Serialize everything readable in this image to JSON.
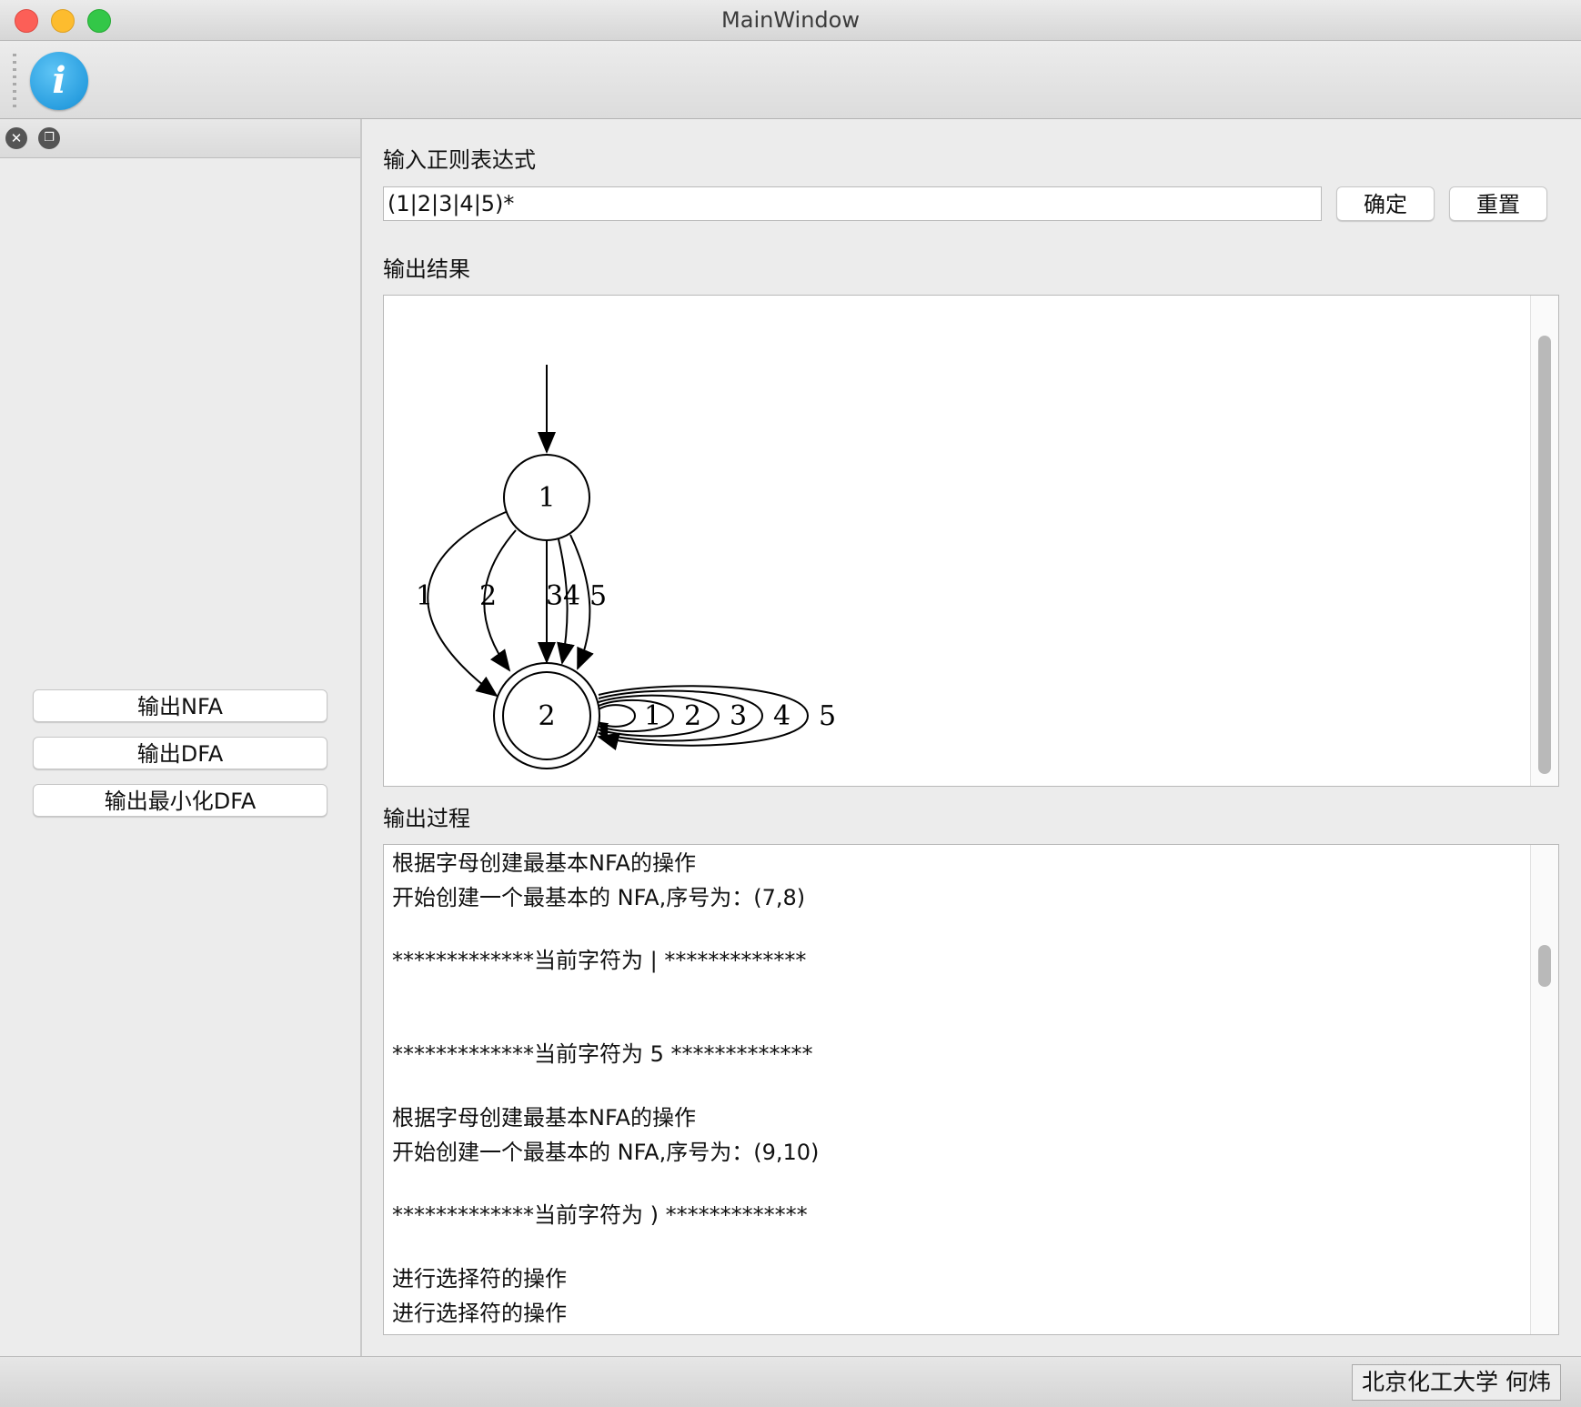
{
  "window": {
    "title": "MainWindow"
  },
  "toolbar": {
    "info_icon": "i"
  },
  "sidebar": {
    "buttons": [
      {
        "label": "输出NFA"
      },
      {
        "label": "输出DFA"
      },
      {
        "label": "输出最小化DFA"
      }
    ]
  },
  "input_section": {
    "label": "输入正则表达式",
    "value": "(1|2|3|4|5)*",
    "confirm_label": "确定",
    "reset_label": "重置"
  },
  "result_section": {
    "label": "输出结果",
    "graph": {
      "states": [
        "1",
        "2"
      ],
      "start_state": "1",
      "accept_state": "2",
      "edges_1_to_2": [
        "1",
        "2",
        "3",
        "4",
        "5"
      ],
      "self_loops_2": [
        "1",
        "2",
        "3",
        "4",
        "5"
      ]
    }
  },
  "process_section": {
    "label": "输出过程",
    "lines": [
      "根据字母创建最基本NFA的操作",
      "开始创建一个最基本的 NFA,序号为：(7,8)",
      "",
      "*************当前字符为 | *************",
      "",
      "",
      "",
      "*************当前字符为 5 *************",
      "",
      "根据字母创建最基本NFA的操作",
      "开始创建一个最基本的 NFA,序号为：(9,10)",
      "",
      "*************当前字符为 ) *************",
      "",
      "进行选择符的操作",
      "进行选择符的操作"
    ]
  },
  "status": {
    "text": "北京化工大学 何炜"
  }
}
